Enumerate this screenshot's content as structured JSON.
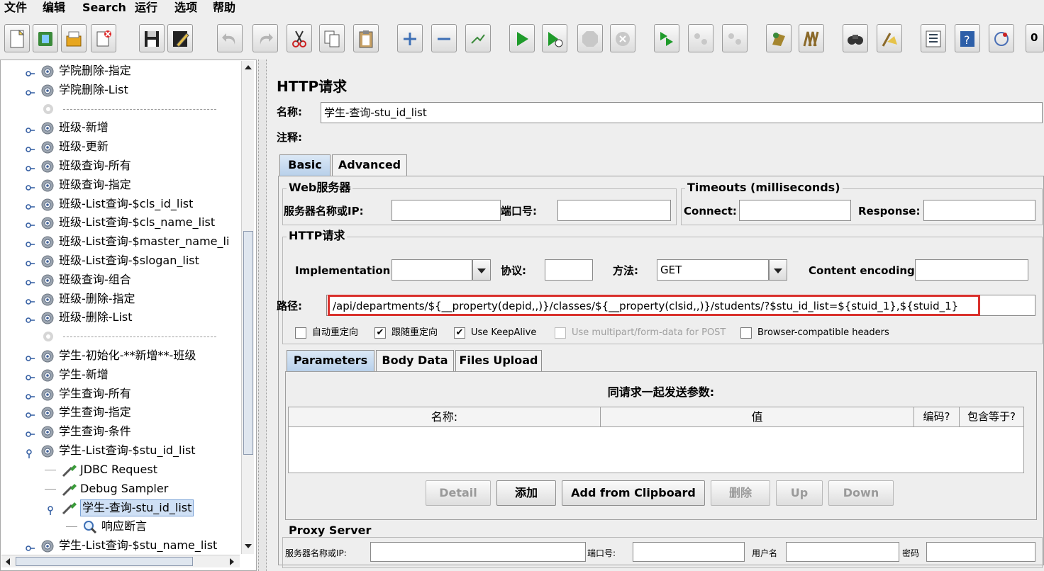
{
  "menu": [
    "文件",
    "编辑",
    "Search",
    "运行",
    "选项",
    "帮助"
  ],
  "toolbar": {
    "buttons": [
      "new-icon",
      "templates-icon",
      "open-icon",
      "close-icon",
      "save-icon",
      "save-as-icon",
      "undo-icon",
      "redo-icon",
      "cut-icon",
      "copy-icon",
      "paste-icon",
      "expand-icon",
      "collapse-icon",
      "toggle-icon",
      "start-icon",
      "start-no-pause-icon",
      "stop-icon",
      "shutdown-icon",
      "remote-start-icon",
      "remote-stop-icon",
      "remote-exit-icon",
      "clear-icon",
      "clear-all-icon",
      "search-icon",
      "reset-search-icon",
      "function-helper-icon",
      "help-icon",
      "log-icon"
    ],
    "counter": "0"
  },
  "tree": {
    "items": [
      {
        "label": "学院删除-指定",
        "type": "controller"
      },
      {
        "label": "学院删除-List",
        "type": "controller"
      },
      {
        "label": "--------------------------------------",
        "type": "separator"
      },
      {
        "label": "班级-新增",
        "type": "controller"
      },
      {
        "label": "班级-更新",
        "type": "controller"
      },
      {
        "label": "班级查询-所有",
        "type": "controller"
      },
      {
        "label": "班级查询-指定",
        "type": "controller"
      },
      {
        "label": "班级-List查询-$cls_id_list",
        "type": "controller"
      },
      {
        "label": "班级-List查询-$cls_name_list",
        "type": "controller"
      },
      {
        "label": "班级-List查询-$master_name_li",
        "type": "controller"
      },
      {
        "label": "班级-List查询-$slogan_list",
        "type": "controller"
      },
      {
        "label": "班级查询-组合",
        "type": "controller"
      },
      {
        "label": "班级-删除-指定",
        "type": "controller"
      },
      {
        "label": "班级-删除-List",
        "type": "controller"
      },
      {
        "label": "--------------------------------------",
        "type": "separator"
      },
      {
        "label": "学生-初始化-**新增**-班级",
        "type": "controller"
      },
      {
        "label": "学生-新增",
        "type": "controller"
      },
      {
        "label": "学生查询-所有",
        "type": "controller"
      },
      {
        "label": "学生查询-指定",
        "type": "controller"
      },
      {
        "label": "学生查询-条件",
        "type": "controller"
      },
      {
        "label": "学生-List查询-$stu_id_list",
        "type": "controller-open"
      },
      {
        "label": "JDBC Request",
        "type": "sampler"
      },
      {
        "label": "Debug Sampler",
        "type": "sampler"
      },
      {
        "label": "学生-查询-stu_id_list",
        "type": "sampler-selected"
      },
      {
        "label": "响应断言",
        "type": "assertion"
      },
      {
        "label": "学生-List查询-$stu_name_list",
        "type": "controller"
      }
    ]
  },
  "panel": {
    "title": "HTTP请求",
    "name_label": "名称:",
    "name_value": "学生-查询-stu_id_list",
    "comment_label": "注释:",
    "comment_value": "",
    "tabs": [
      "Basic",
      "Advanced"
    ],
    "web_server": {
      "legend": "Web服务器",
      "server_label": "服务器名称或IP:",
      "server_value": "",
      "port_label": "端口号:",
      "port_value": ""
    },
    "timeouts": {
      "legend": "Timeouts (milliseconds)",
      "connect_label": "Connect:",
      "connect_value": "",
      "response_label": "Response:",
      "response_value": ""
    },
    "http": {
      "legend": "HTTP请求",
      "impl_label": "Implementation:",
      "impl_value": "",
      "protocol_label": "协议:",
      "protocol_value": "",
      "method_label": "方法:",
      "method_value": "GET",
      "encoding_label": "Content encoding:",
      "encoding_value": "",
      "path_label": "路径:",
      "path_value": "/api/departments/${__property(depid,,)}/classes/${__property(clsid,,)}/students/?$stu_id_list=${stuid_1},${stuid_1}",
      "highlight_color": "#d9302c"
    },
    "options": [
      {
        "label": "自动重定向",
        "checked": false,
        "enabled": true
      },
      {
        "label": "跟随重定向",
        "checked": true,
        "enabled": true
      },
      {
        "label": "Use KeepAlive",
        "checked": true,
        "enabled": true
      },
      {
        "label": "Use multipart/form-data for POST",
        "checked": false,
        "enabled": false
      },
      {
        "label": "Browser-compatible headers",
        "checked": false,
        "enabled": true
      }
    ],
    "param_tabs": [
      "Parameters",
      "Body Data",
      "Files Upload"
    ],
    "params": {
      "caption": "同请求一起发送参数:",
      "columns": [
        "名称:",
        "值",
        "编码?",
        "包含等于?"
      ]
    },
    "buttons": [
      {
        "label": "Detail",
        "enabled": false
      },
      {
        "label": "添加",
        "enabled": true
      },
      {
        "label": "Add from Clipboard",
        "enabled": true
      },
      {
        "label": "删除",
        "enabled": false
      },
      {
        "label": "Up",
        "enabled": false
      },
      {
        "label": "Down",
        "enabled": false
      }
    ],
    "proxy": {
      "legend": "Proxy Server",
      "server_label": "服务器名称或IP:",
      "port_label": "端口号:",
      "user_label": "用户名",
      "password_label": "密码"
    }
  }
}
